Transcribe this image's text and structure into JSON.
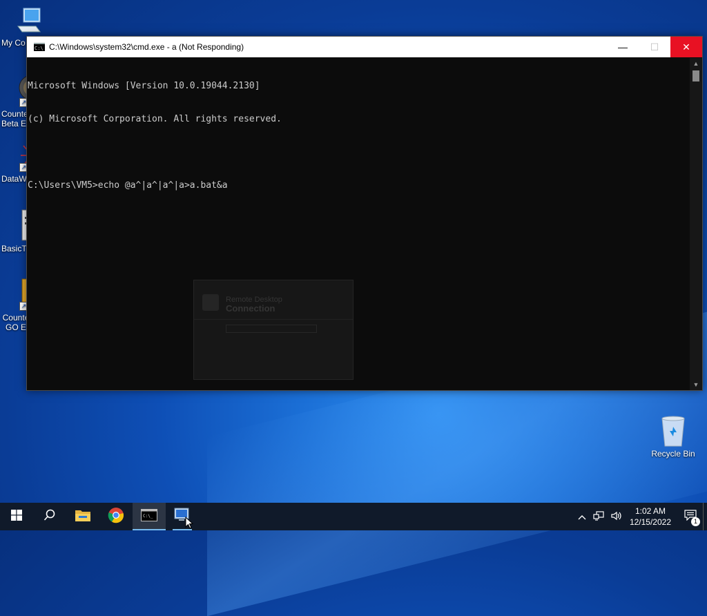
{
  "desktop": {
    "icons": [
      {
        "label": "My Co",
        "icon": "computer-icon"
      },
      {
        "label": "Counte Beta E",
        "icon": "counter-strike-icon"
      },
      {
        "label": "DataW",
        "icon": "data-app-icon"
      },
      {
        "label": "BasicTh",
        "icon": "document-app-icon"
      },
      {
        "label": "Counte GO E",
        "icon": "csgo-icon"
      }
    ],
    "recycle_bin": {
      "label": "Recycle Bin",
      "icon": "recycle-bin-icon"
    }
  },
  "cmd_window": {
    "title": "C:\\Windows\\system32\\cmd.exe - a (Not Responding)",
    "lines": [
      "Microsoft Windows [Version 10.0.19044.2130]",
      "(c) Microsoft Corporation. All rights reserved.",
      "",
      "C:\\Users\\VM5>echo @a^|a^|a^|a>a.bat&a"
    ],
    "buttons": {
      "minimize": "—",
      "maximize": "☐",
      "close": "✕"
    }
  },
  "ghost_dialog": {
    "title_line1": "Remote Desktop",
    "title_line2": "Connection"
  },
  "taskbar": {
    "items": [
      {
        "name": "start",
        "icon": "windows-logo-icon"
      },
      {
        "name": "search",
        "icon": "search-icon"
      },
      {
        "name": "file-explorer",
        "icon": "folder-icon"
      },
      {
        "name": "chrome",
        "icon": "chrome-icon"
      },
      {
        "name": "cmd",
        "icon": "cmd-icon"
      },
      {
        "name": "remote-desktop",
        "icon": "remote-desktop-icon"
      }
    ],
    "clock": {
      "time": "1:02 AM",
      "date": "12/15/2022"
    },
    "notification_count": "1"
  },
  "colors": {
    "console_bg": "#0c0c0c",
    "console_fg": "#cccccc",
    "close_red": "#e81123",
    "taskbar_bg": "#101a2a",
    "accent": "#76b9ed"
  }
}
